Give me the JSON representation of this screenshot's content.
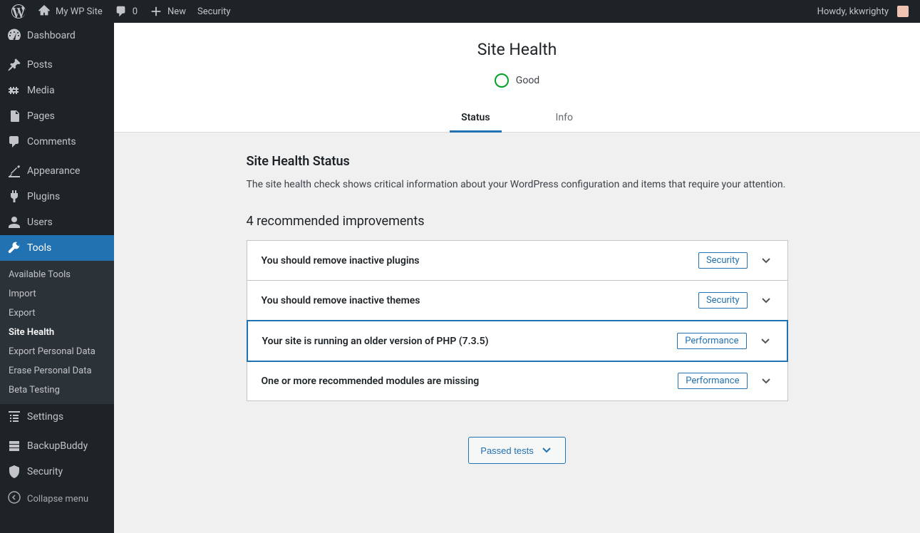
{
  "adminbar": {
    "siteName": "My WP Site",
    "commentCount": "0",
    "newLabel": "New",
    "securityLabel": "Security",
    "howdy": "Howdy, kkwrighty"
  },
  "sidebar": {
    "main": [
      {
        "id": "dashboard",
        "label": "Dashboard"
      },
      {
        "id": "posts",
        "label": "Posts"
      },
      {
        "id": "media",
        "label": "Media"
      },
      {
        "id": "pages",
        "label": "Pages"
      },
      {
        "id": "comments",
        "label": "Comments"
      },
      {
        "id": "appearance",
        "label": "Appearance"
      },
      {
        "id": "plugins",
        "label": "Plugins"
      },
      {
        "id": "users",
        "label": "Users"
      },
      {
        "id": "tools",
        "label": "Tools"
      },
      {
        "id": "settings",
        "label": "Settings"
      },
      {
        "id": "backupbuddy",
        "label": "BackupBuddy"
      },
      {
        "id": "security",
        "label": "Security"
      }
    ],
    "submenu": [
      "Available Tools",
      "Import",
      "Export",
      "Site Health",
      "Export Personal Data",
      "Erase Personal Data",
      "Beta Testing"
    ],
    "collapse": "Collapse menu"
  },
  "health": {
    "title": "Site Health",
    "status": "Good",
    "tabs": {
      "status": "Status",
      "info": "Info"
    },
    "sectionTitle": "Site Health Status",
    "sectionDesc": "The site health check shows critical information about your WordPress configuration and items that require your attention.",
    "improvementsTitle": "4 recommended improvements",
    "checks": [
      {
        "label": "You should remove inactive plugins",
        "badge": "Security",
        "badgeType": "security",
        "highlighted": false
      },
      {
        "label": "You should remove inactive themes",
        "badge": "Security",
        "badgeType": "security",
        "highlighted": false
      },
      {
        "label": "Your site is running an older version of PHP (7.3.5)",
        "badge": "Performance",
        "badgeType": "performance",
        "highlighted": true
      },
      {
        "label": "One or more recommended modules are missing",
        "badge": "Performance",
        "badgeType": "performance",
        "highlighted": false
      }
    ],
    "passedLabel": "Passed tests"
  }
}
